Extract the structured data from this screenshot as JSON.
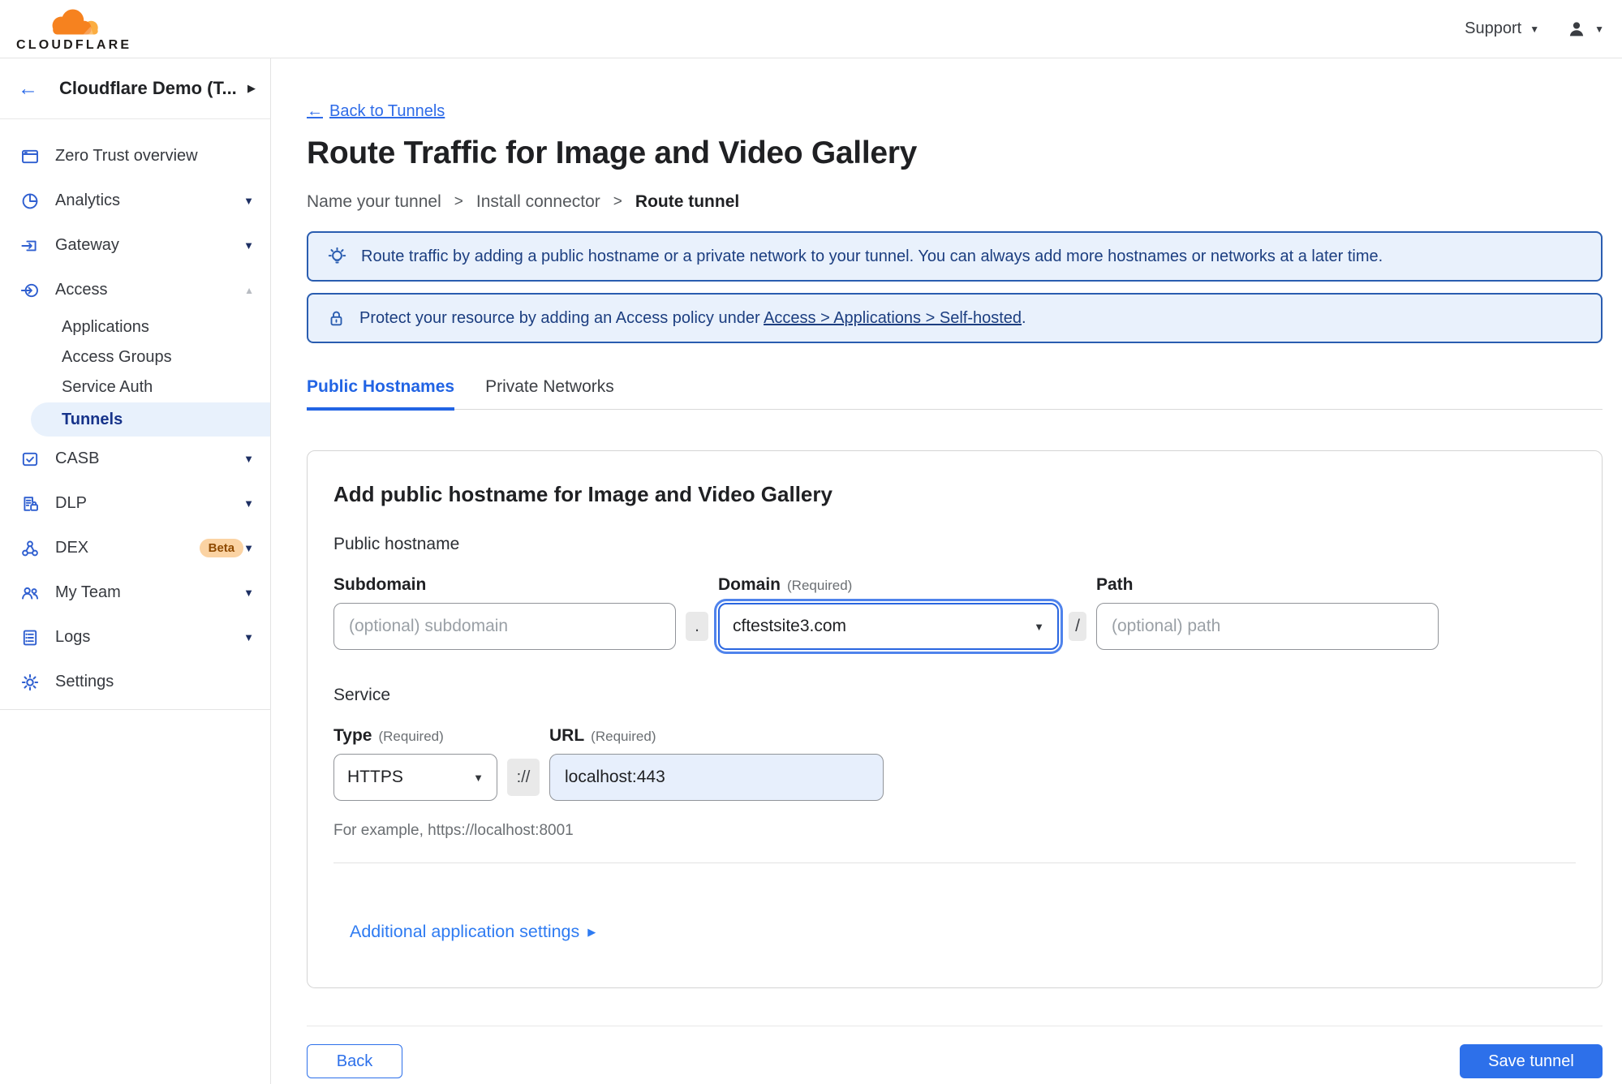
{
  "header": {
    "logo_text": "CLOUDFLARE",
    "support_label": "Support"
  },
  "icons": {
    "back_arrow": "←",
    "chevron_down": "▼",
    "chevron_up": "▲",
    "expand_right": "▶",
    "breadcrumb_separator": ">",
    "dropdown_caret": "▼",
    "settings_arrow": "▶"
  },
  "sidebar": {
    "account_name": "Cloudflare Demo (T...",
    "items": [
      {
        "label": "Zero Trust overview"
      },
      {
        "label": "Analytics"
      },
      {
        "label": "Gateway"
      },
      {
        "label": "Access"
      },
      {
        "label": "CASB"
      },
      {
        "label": "DLP"
      },
      {
        "label": "DEX",
        "badge": "Beta"
      },
      {
        "label": "My Team"
      },
      {
        "label": "Logs"
      },
      {
        "label": "Settings"
      }
    ],
    "access_subitems": [
      {
        "label": "Applications"
      },
      {
        "label": "Access Groups"
      },
      {
        "label": "Service Auth"
      },
      {
        "label": "Tunnels",
        "active": true
      }
    ]
  },
  "main": {
    "back_link": "Back to Tunnels",
    "title": "Route Traffic for Image and Video Gallery",
    "steps": [
      {
        "label": "Name your tunnel"
      },
      {
        "label": "Install connector"
      },
      {
        "label": "Route tunnel"
      }
    ],
    "banners": [
      {
        "icon": "lightbulb-icon",
        "text": "Route traffic by adding a public hostname or a private network to your tunnel. You can always add more hostnames or networks at a later time."
      },
      {
        "icon": "lock-icon",
        "text_before": "Protect your resource by adding an Access policy under",
        "link_text": "Access > Applications > Self-hosted",
        "text_after": "."
      }
    ],
    "tabs": [
      {
        "label": "Public Hostnames"
      },
      {
        "label": "Private Networks"
      }
    ],
    "form": {
      "heading": "Add public hostname for Image and Video Gallery",
      "section_public_hostname": "Public hostname",
      "subdomain_label": "Subdomain",
      "subdomain_placeholder": "(optional) subdomain",
      "dot_separator": ".",
      "domain_label": "Domain",
      "domain_required": "(Required)",
      "domain_value": "cftestsite3.com",
      "slash_separator": "/",
      "path_label": "Path",
      "path_placeholder": "(optional) path",
      "section_service": "Service",
      "type_label": "Type",
      "type_required": "(Required)",
      "type_value": "HTTPS",
      "scheme_separator": "://",
      "url_label": "URL",
      "url_required": "(Required)",
      "url_value": "localhost:443",
      "example_hint": "For example, https://localhost:8001",
      "additional_settings": "Additional application settings"
    },
    "footer": {
      "back_label": "Back",
      "save_label": "Save tunnel"
    }
  },
  "colors": {
    "accent_blue": "#2d70ea",
    "banner_background": "#e9f1fc",
    "banner_border": "#2a5db0",
    "banner_text": "#1c3e80",
    "active_nav_background": "#e8f1fc",
    "active_nav_text": "#16338a",
    "sidebar_icon_blue": "#2f5fd0",
    "beta_badge_background": "#fbd3a3",
    "beta_badge_text": "#8f4a00",
    "url_field_background": "#e7effc",
    "logo_orange": "#f6821f",
    "logo_orange_light": "#fbad41"
  }
}
